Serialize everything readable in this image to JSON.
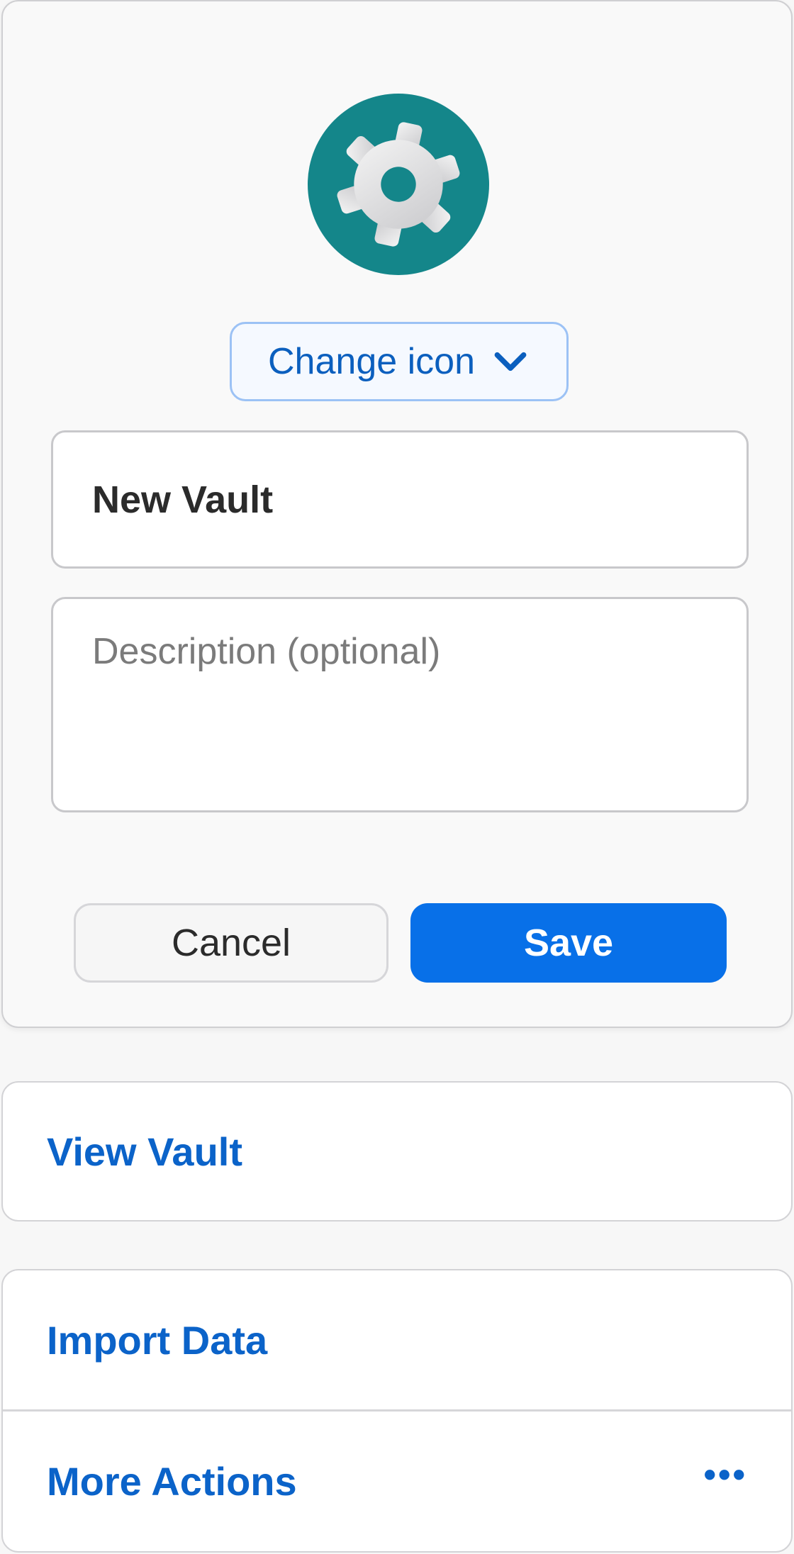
{
  "editor": {
    "vault_icon": "gear-icon",
    "change_icon_label": "Change icon",
    "name_value": "New Vault",
    "description_placeholder": "Description (optional)",
    "cancel_label": "Cancel",
    "save_label": "Save"
  },
  "actions": {
    "view_vault_label": "View Vault",
    "import_data_label": "Import Data",
    "more_actions_label": "More Actions",
    "more_icon": "ellipsis-icon"
  },
  "colors": {
    "accent": "#0870e8",
    "link": "#0b63c9",
    "icon_background": "#14868a"
  }
}
